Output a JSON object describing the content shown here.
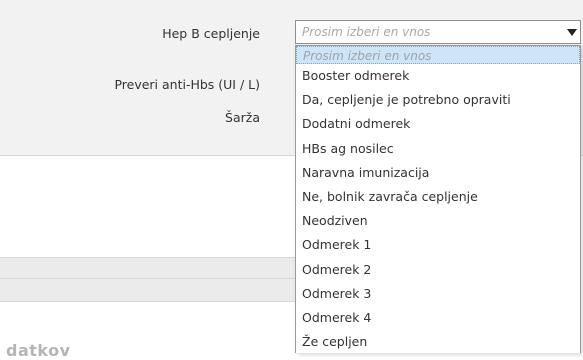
{
  "form": {
    "hep_b_label": "Hep B cepljenje",
    "anti_hbs_label": "Preveri anti-Hbs (UI / L)",
    "sarza_label": "Šarža"
  },
  "hep_b_select": {
    "value": "Prosim izberi en vnos",
    "arrow_icon": "triangle-down-icon"
  },
  "dropdown": {
    "options": [
      "Prosim izberi en vnos",
      "Booster odmerek",
      "Da, cepljenje je potrebno opraviti",
      "Dodatni odmerek",
      "HBs ag nosilec",
      "Naravna imunizacija",
      "Ne, bolnik zavrača cepljenje",
      "Neodziven",
      "Odmerek 1",
      "Odmerek 2",
      "Odmerek 3",
      "Odmerek 4",
      "Že cepljen"
    ],
    "highlight_color": "#cde6f7"
  },
  "footer": {
    "partial_text": "datkov"
  }
}
